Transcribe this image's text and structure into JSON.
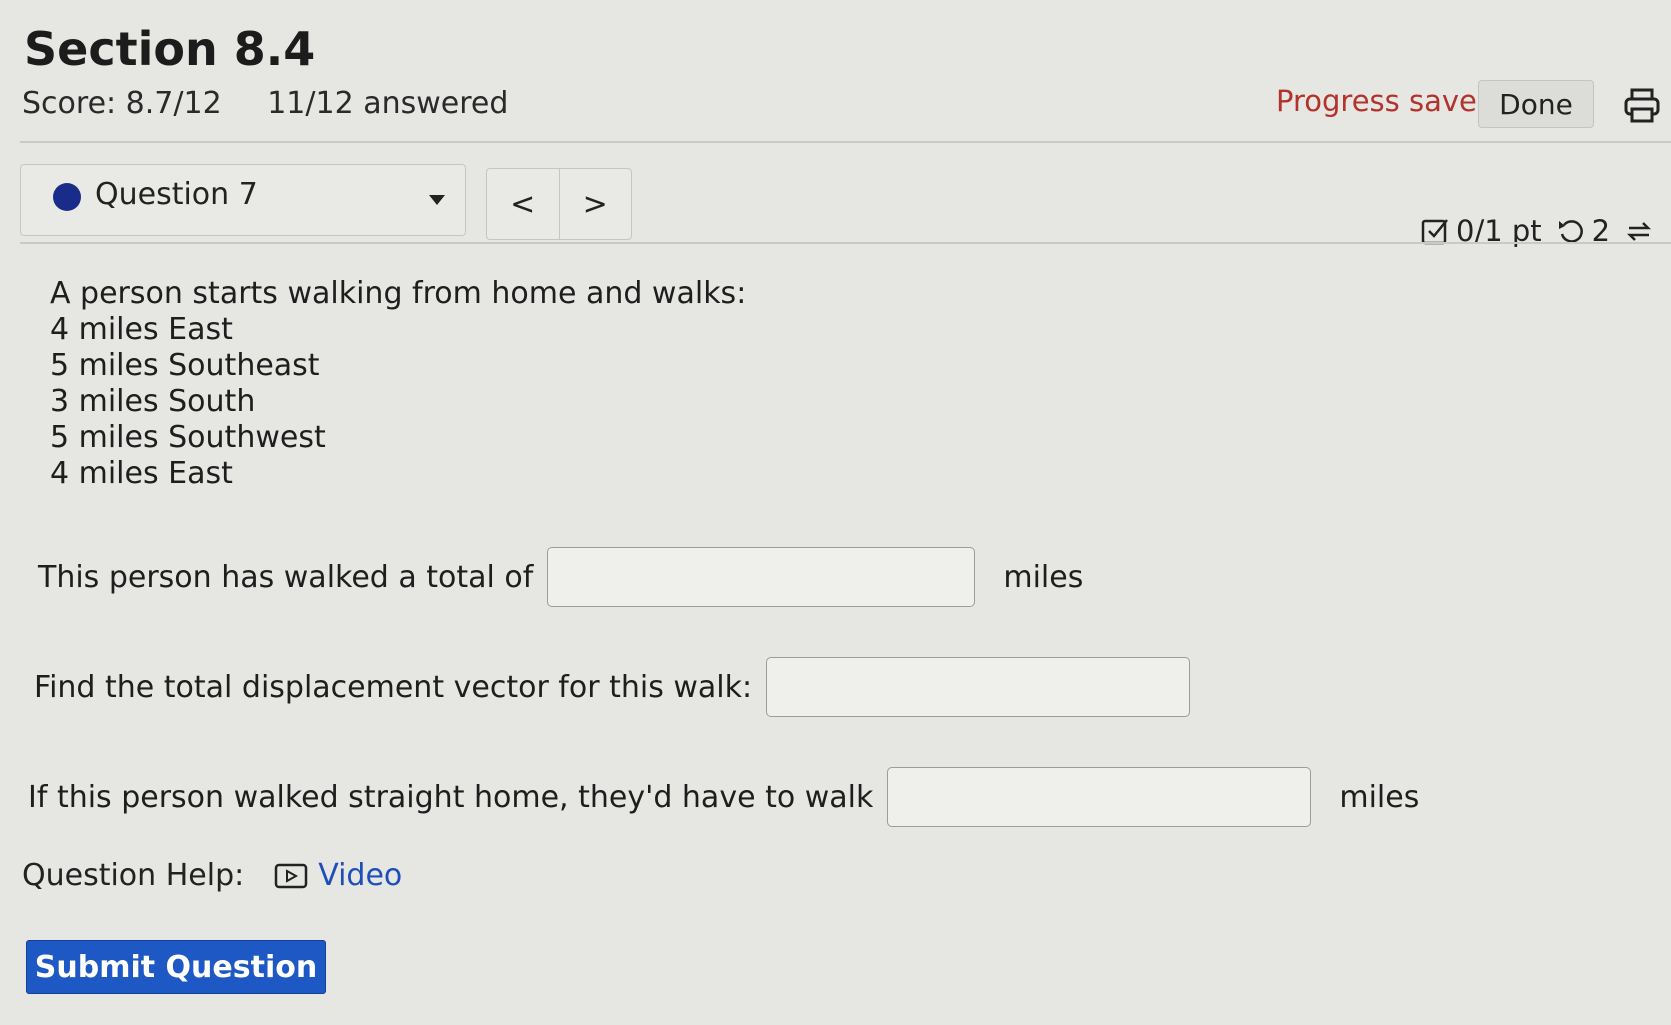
{
  "header": {
    "title": "Section 8.4",
    "score": "Score: 8.7/12",
    "answered": "11/12 answered",
    "progress_status": "Progress saved",
    "done_label": "Done"
  },
  "question_nav": {
    "selected": "Question 7",
    "prev_label": "<",
    "next_label": ">"
  },
  "points": {
    "score": "0/1 pt",
    "attempts": "2"
  },
  "problem": {
    "intro": "A person starts walking from home and walks:",
    "legs": [
      "4 miles East",
      "5 miles Southeast",
      "3 miles South",
      "5 miles Southwest",
      "4 miles East"
    ]
  },
  "answers": [
    {
      "label": "This person has walked a total of",
      "value": "",
      "unit": "miles"
    },
    {
      "label": "Find the total displacement vector for this walk:",
      "value": "",
      "unit": ""
    },
    {
      "label": "If this person walked straight home, they'd have to walk",
      "value": "",
      "unit": "miles"
    }
  ],
  "help": {
    "label": "Question Help:",
    "video_label": "Video"
  },
  "submit_label": "Submit Question",
  "colors": {
    "accent": "#1d58c4",
    "progress_text": "#b2332b",
    "link": "#1e4fb8"
  }
}
